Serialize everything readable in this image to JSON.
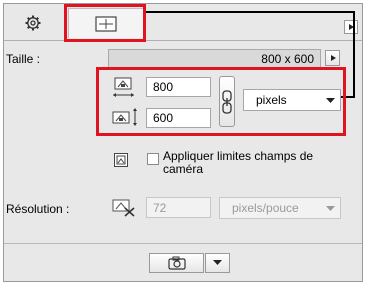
{
  "tabs": [
    {
      "name": "settings",
      "icon": "gear-icon"
    },
    {
      "name": "size",
      "icon": "frame-size-icon"
    }
  ],
  "header_right_button_icon": "play-triangle-icon",
  "size": {
    "label": "Taille :",
    "dimension_text": "800 x 600",
    "width_value": "800",
    "height_value": "600",
    "unit": "pixels"
  },
  "camera_limits": {
    "label": "Appliquer limites champs de caméra",
    "checked": false
  },
  "resolution": {
    "label": "Résolution :",
    "value": "72",
    "unit": "pixels/pouce"
  },
  "colors": {
    "highlight": "#e0141e",
    "panel_bg": "#e8e8e8"
  }
}
